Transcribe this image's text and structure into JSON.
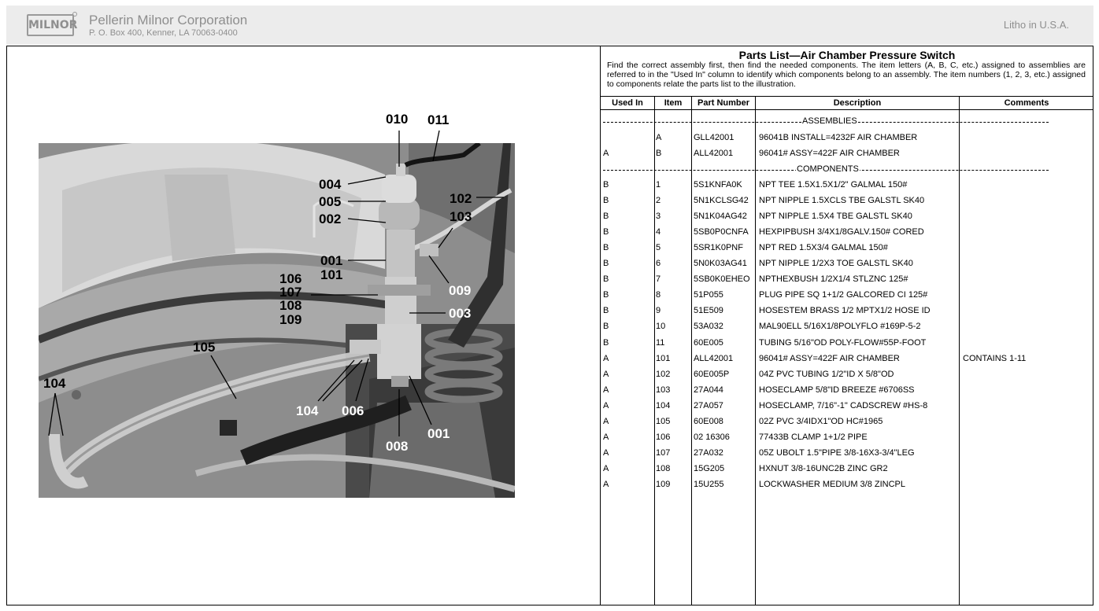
{
  "header": {
    "logo_text": "MILNOR",
    "company": "Pellerin Milnor Corporation",
    "address": "P. O. Box 400, Kenner, LA 70063-0400",
    "litho": "Litho in U.S.A."
  },
  "parts_list": {
    "title": "Parts List—Air Chamber Pressure Switch",
    "intro": "Find the correct assembly first, then find the needed components. The item letters (A, B, C, etc.) assigned to assemblies are referred to in the \"Used In\" column to identify which components belong to an assembly. The item numbers (1, 2, 3, etc.) assigned to components relate the parts list to the illustration.",
    "columns": [
      "Used In",
      "Item",
      "Part Number",
      "Description",
      "Comments"
    ],
    "section_assemblies": "ASSEMBLIES",
    "section_components": "COMPONENTS",
    "assemblies": [
      {
        "used_in": "",
        "item": "A",
        "part": "GLL42001",
        "desc": "96041B INSTALL=4232F AIR CHAMBER",
        "comment": ""
      },
      {
        "used_in": "A",
        "item": "B",
        "part": "ALL42001",
        "desc": "96041# ASSY=422F AIR CHAMBER",
        "comment": ""
      }
    ],
    "components": [
      {
        "used_in": "B",
        "item": "1",
        "part": "5S1KNFA0K",
        "desc": "NPT TEE 1.5X1.5X1/2\" GALMAL 150#",
        "comment": ""
      },
      {
        "used_in": "B",
        "item": "2",
        "part": "5N1KCLSG42",
        "desc": "NPT NIPPLE 1.5XCLS TBE GALSTL SK40",
        "comment": ""
      },
      {
        "used_in": "B",
        "item": "3",
        "part": "5N1K04AG42",
        "desc": "NPT NIPPLE 1.5X4   TBE GALSTL SK40",
        "comment": ""
      },
      {
        "used_in": "B",
        "item": "4",
        "part": "5SB0P0CNFA",
        "desc": "HEXPIPBUSH 3/4X1/8GALV.150# CORED",
        "comment": ""
      },
      {
        "used_in": "B",
        "item": "5",
        "part": "5SR1K0PNF",
        "desc": "NPT RED 1.5X3/4 GALMAL 150#",
        "comment": ""
      },
      {
        "used_in": "B",
        "item": "6",
        "part": "5N0K03AG41",
        "desc": "NPT NIPPLE 1/2X3 TOE GALSTL SK40",
        "comment": ""
      },
      {
        "used_in": "B",
        "item": "7",
        "part": "5SB0K0EHEO",
        "desc": "NPTHEXBUSH 1/2X1/4 STLZNC 125#",
        "comment": ""
      },
      {
        "used_in": "B",
        "item": "8",
        "part": "51P055",
        "desc": "PLUG PIPE SQ 1+1/2 GALCORED CI 125#",
        "comment": ""
      },
      {
        "used_in": "B",
        "item": "9",
        "part": "51E509",
        "desc": "HOSESTEM BRASS 1/2 MPTX1/2 HOSE ID",
        "comment": ""
      },
      {
        "used_in": "B",
        "item": "10",
        "part": "53A032",
        "desc": "MAL90ELL 5/16X1/8POLYFLO  #169P-5-2",
        "comment": ""
      },
      {
        "used_in": "B",
        "item": "11",
        "part": "60E005",
        "desc": "TUBING 5/16\"OD POLY-FLOW#55P-FOOT",
        "comment": ""
      },
      {
        "used_in": "A",
        "item": "101",
        "part": "ALL42001",
        "desc": "96041# ASSY=422F AIR CHAMBER",
        "comment": "CONTAINS 1-11"
      },
      {
        "used_in": "A",
        "item": "102",
        "part": "60E005P",
        "desc": "04Z PVC TUBING 1/2\"ID X 5/8\"OD",
        "comment": ""
      },
      {
        "used_in": "A",
        "item": "103",
        "part": "27A044",
        "desc": "HOSECLAMP 5/8\"ID  BREEZE #6706SS",
        "comment": ""
      },
      {
        "used_in": "A",
        "item": "104",
        "part": "27A057",
        "desc": "HOSECLAMP, 7/16\"-1\" CADSCREW #HS-8",
        "comment": ""
      },
      {
        "used_in": "A",
        "item": "105",
        "part": "60E008",
        "desc": "02Z PVC 3/4IDX1\"OD HC#1965",
        "comment": ""
      },
      {
        "used_in": "A",
        "item": "106",
        "part": "02 16306",
        "desc": "77433B CLAMP 1+1/2 PIPE",
        "comment": ""
      },
      {
        "used_in": "A",
        "item": "107",
        "part": "27A032",
        "desc": "05Z UBOLT 1.5\"PIPE 3/8-16X3-3/4\"LEG",
        "comment": ""
      },
      {
        "used_in": "A",
        "item": "108",
        "part": "15G205",
        "desc": "HXNUT 3/8-16UNC2B ZINC GR2",
        "comment": ""
      },
      {
        "used_in": "A",
        "item": "109",
        "part": "15U255",
        "desc": "LOCKWASHER MEDIUM 3/8 ZINCPL",
        "comment": ""
      }
    ]
  },
  "illustration": {
    "callouts": {
      "c010": "010",
      "c011": "011",
      "c004": "004",
      "c005": "005",
      "c002": "002",
      "c102": "102",
      "c103": "103",
      "c001a": "001",
      "c101": "101",
      "c106": "106",
      "c107": "107",
      "c108": "108",
      "c109": "109",
      "c009": "009",
      "c003": "003",
      "c105": "105",
      "c104a": "104",
      "c104b": "104",
      "c006": "006",
      "c008": "008",
      "c001b": "001"
    }
  }
}
